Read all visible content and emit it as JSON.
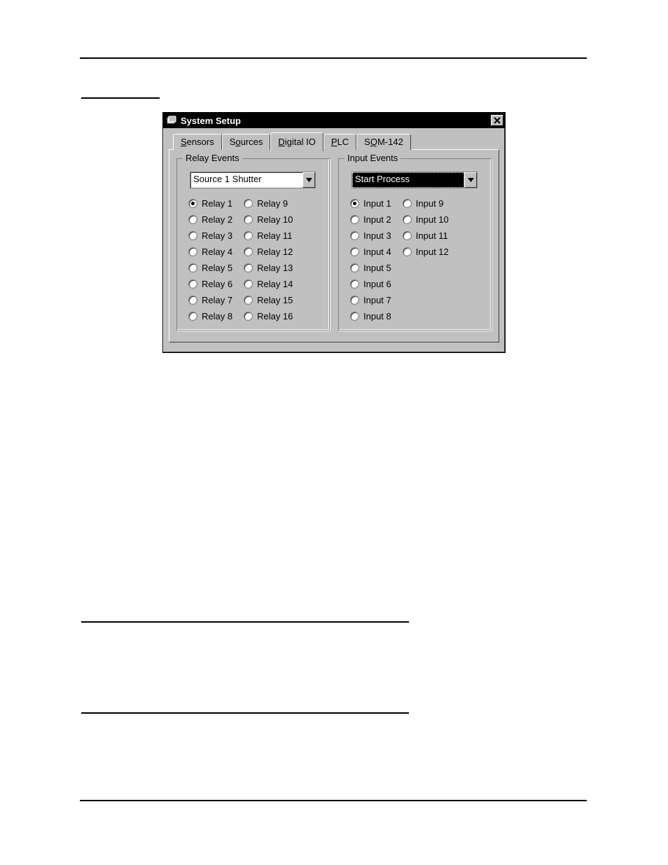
{
  "dialog": {
    "title": "System Setup",
    "tabs": [
      {
        "label": "Sensors",
        "mnemonic": 0
      },
      {
        "label": "Sources",
        "mnemonic": 1
      },
      {
        "label": "Digital IO",
        "mnemonic": 0,
        "active": true
      },
      {
        "label": "PLC",
        "mnemonic": 0
      },
      {
        "label": "SQM-142",
        "mnemonic": 1
      }
    ],
    "relay": {
      "legend": "Relay Events",
      "selected_event": "Source 1 Shutter",
      "selected_radio": "Relay 1",
      "col1": [
        "Relay 1",
        "Relay 2",
        "Relay 3",
        "Relay 4",
        "Relay 5",
        "Relay 6",
        "Relay 7",
        "Relay 8"
      ],
      "col2": [
        "Relay 9",
        "Relay 10",
        "Relay 11",
        "Relay 12",
        "Relay 13",
        "Relay 14",
        "Relay 15",
        "Relay 16"
      ]
    },
    "input": {
      "legend": "Input Events",
      "selected_event": "Start Process",
      "selected_radio": "Input 1",
      "col1": [
        "Input 1",
        "Input 2",
        "Input 3",
        "Input 4",
        "Input 5",
        "Input 6",
        "Input 7",
        "Input 8"
      ],
      "col2": [
        "Input 9",
        "Input 10",
        "Input 11",
        "Input 12"
      ]
    }
  }
}
